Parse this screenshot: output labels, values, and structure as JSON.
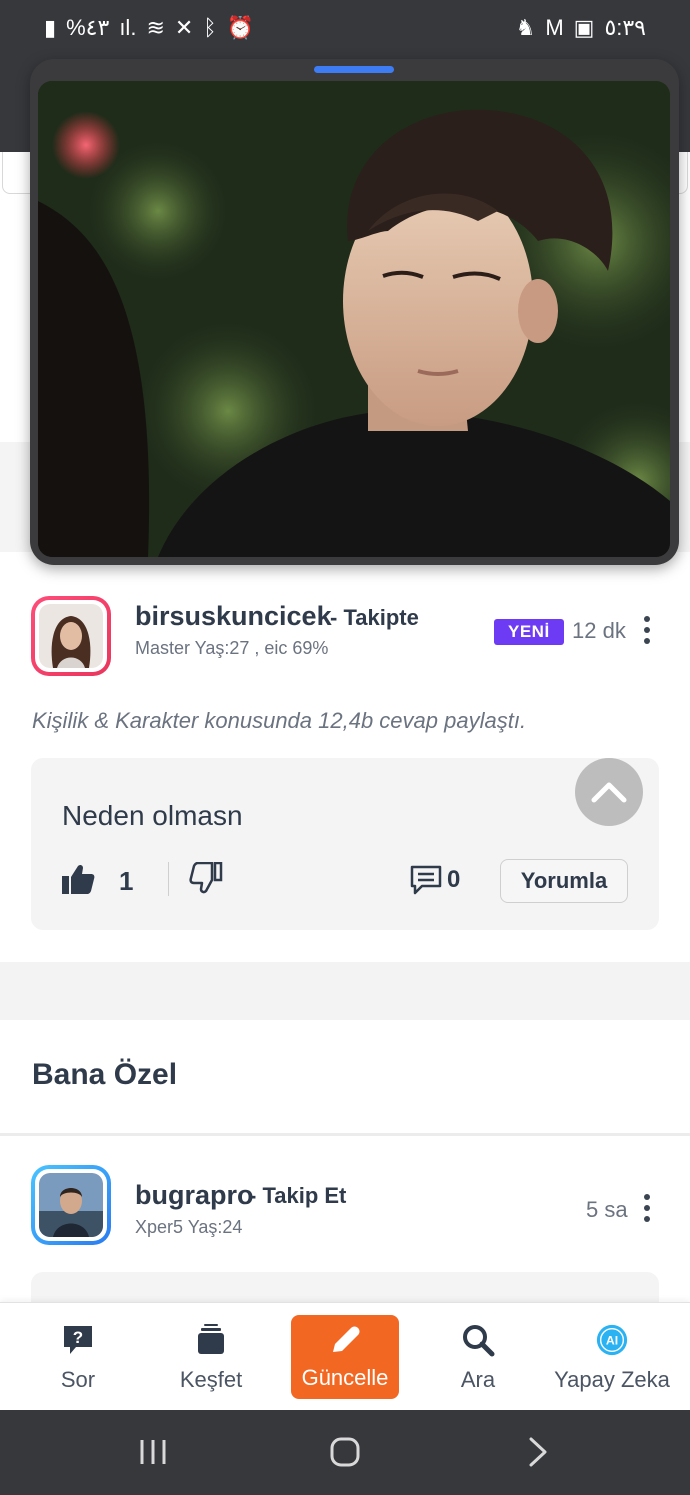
{
  "status_bar": {
    "left": "%٤٣",
    "time": "٥:٣٩"
  },
  "feed_item_1": {
    "username": "birsuskuncicek",
    "follow_state": "- Takipte",
    "meta": "Master Yaş:27 , eic 69%",
    "badge": "YENİ",
    "time": "12 dk",
    "activity": "Kişilik & Karakter konusunda 12,4b cevap paylaştı.",
    "answer_text": "Neden olmasn",
    "like_count": "1",
    "comment_count": "0",
    "comment_button": "Yorumla"
  },
  "section": {
    "title": "Bana Özel"
  },
  "feed_item_2": {
    "username": "bugrapro",
    "follow_state": "- Takip Et",
    "meta": "Xper5 Yaş:24",
    "time": "5 sa"
  },
  "bottom_nav": {
    "items": [
      {
        "label": "Sor",
        "icon": "question-bubble-icon"
      },
      {
        "label": "Keşfet",
        "icon": "stack-icon"
      },
      {
        "label": "Güncelle",
        "icon": "pencil-icon",
        "active": true
      },
      {
        "label": "Ara",
        "icon": "search-icon"
      },
      {
        "label": "Yapay Zeka",
        "icon": "ai-icon"
      }
    ]
  },
  "colors": {
    "accent": "#f26722",
    "badge": "#6e3bf5",
    "dark": "#36383c",
    "pip_handle": "#3e7cf4"
  }
}
